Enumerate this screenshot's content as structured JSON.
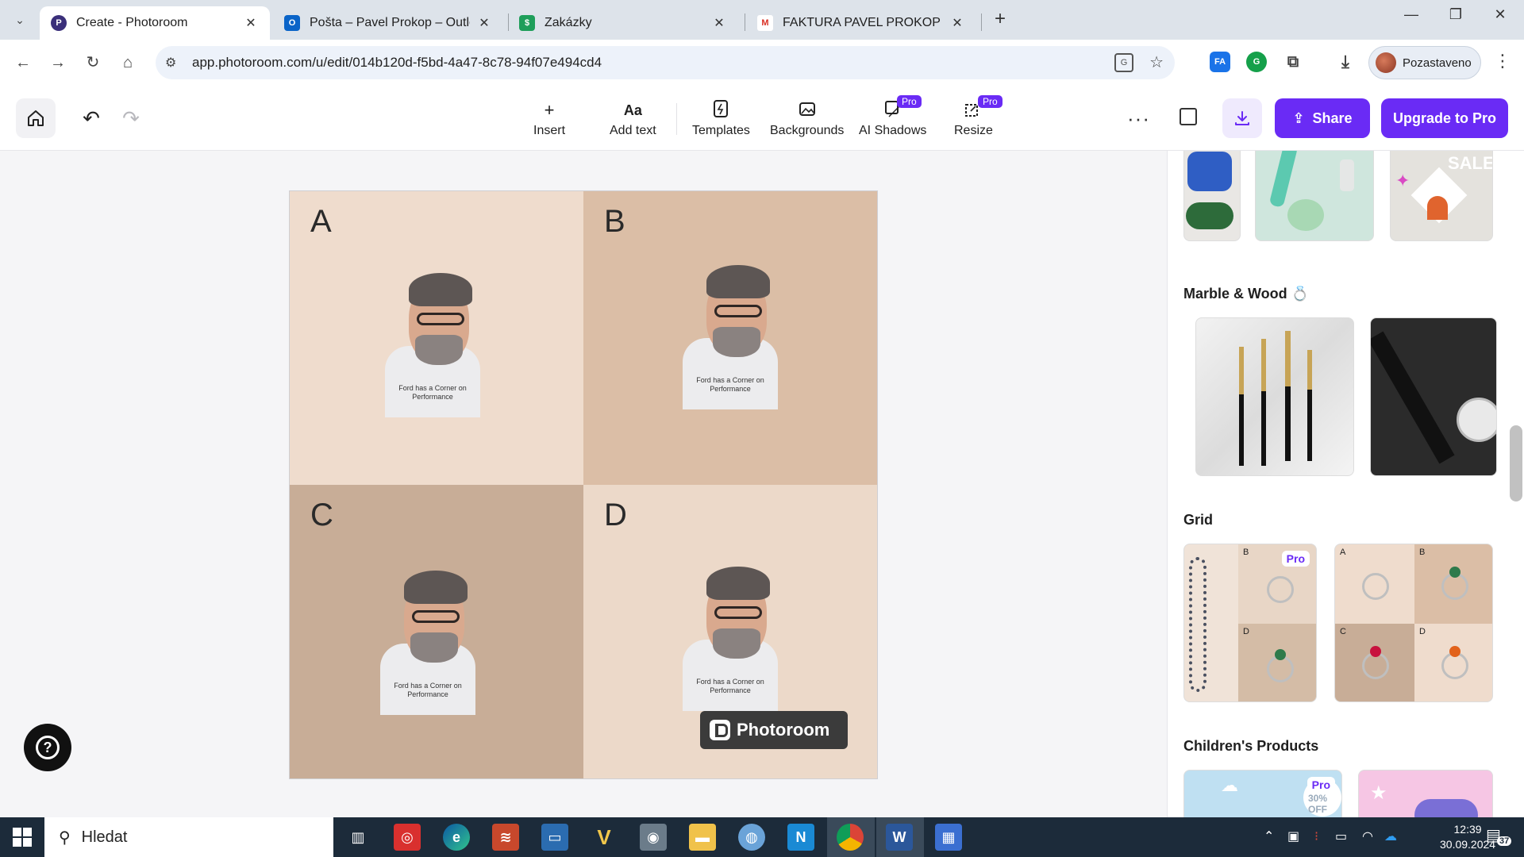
{
  "browser": {
    "tabs": [
      {
        "title": "Create - Photoroom",
        "icon": "photoroom-icon"
      },
      {
        "title": "Pošta – Pavel Prokop – Outlook",
        "icon": "outlook-icon"
      },
      {
        "title": "Zakázky",
        "icon": "sheets-icon"
      },
      {
        "title": "FAKTURA PAVEL PROKOP - pav",
        "icon": "gmail-icon"
      }
    ],
    "url": "app.photoroom.com/u/edit/014b120d-f5bd-4a47-8c78-94f07e494cd4",
    "profile_label": "Pozastaveno",
    "extension_fa_label": "FA"
  },
  "toolbar": {
    "items": [
      {
        "label": "Insert",
        "icon": "+"
      },
      {
        "label": "Add text",
        "icon": "Aa"
      },
      {
        "label": "Templates",
        "icon": "templates-icon"
      },
      {
        "label": "Backgrounds",
        "icon": "backgrounds-icon"
      },
      {
        "label": "AI Shadows",
        "icon": "ai-shadows-icon",
        "badge": "Pro"
      },
      {
        "label": "Resize",
        "icon": "resize-icon",
        "badge": "Pro"
      }
    ],
    "share_label": "Share",
    "upgrade_label": "Upgrade to Pro"
  },
  "canvas": {
    "cells": [
      {
        "letter": "A",
        "bg": "#efdccd"
      },
      {
        "letter": "B",
        "bg": "#dbbea6"
      },
      {
        "letter": "C",
        "bg": "#c8ad97"
      },
      {
        "letter": "D",
        "bg": "#ecd9c9"
      }
    ],
    "shirt_text": "Ford has a Corner on Performance",
    "watermark_label": "Photoroom"
  },
  "panel": {
    "sections": [
      {
        "title": "Marble & Wood 💍"
      },
      {
        "title": "Grid"
      },
      {
        "title": "Children's Products"
      }
    ],
    "top_card_text": "SALE",
    "grid_badge": "Pro",
    "children_badge": "Pro",
    "children_card_text": "30% OFF",
    "grid_letters": [
      "A",
      "B",
      "C",
      "D"
    ]
  },
  "taskbar": {
    "search_placeholder": "Hledat",
    "time": "12:39",
    "date": "30.09.2024",
    "notifications": "37"
  },
  "colors": {
    "accent": "#6a2bf5",
    "taskbar": "#1c2b3a"
  }
}
